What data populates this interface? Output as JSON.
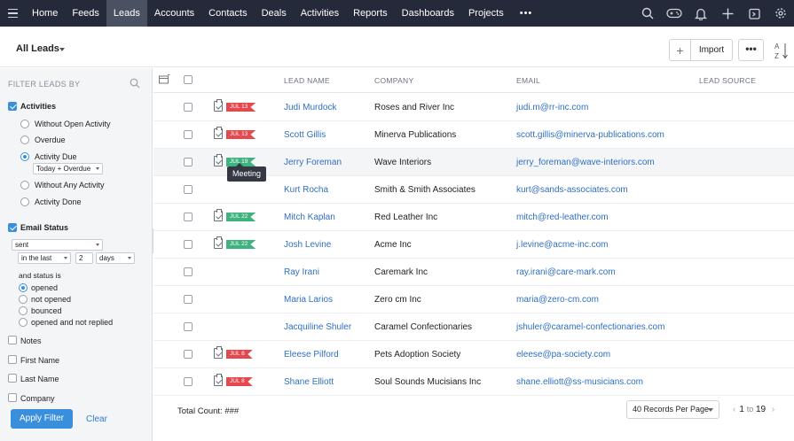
{
  "nav": {
    "tabs": [
      {
        "label": "Home",
        "active": false
      },
      {
        "label": "Feeds",
        "active": false
      },
      {
        "label": "Leads",
        "active": true
      },
      {
        "label": "Accounts",
        "active": false
      },
      {
        "label": "Contacts",
        "active": false
      },
      {
        "label": "Deals",
        "active": false
      },
      {
        "label": "Activities",
        "active": false
      },
      {
        "label": "Reports",
        "active": false
      },
      {
        "label": "Dashboards",
        "active": false
      },
      {
        "label": "Projects",
        "active": false
      }
    ],
    "more": "•••",
    "icons": [
      "search-icon",
      "gamepad-icon",
      "bell-icon",
      "plus-icon",
      "calendar-icon",
      "settings-icon"
    ]
  },
  "header": {
    "view_title": "All Leads",
    "import_label": "Import",
    "more_label": "•••",
    "plus_label": "+",
    "sort_label_a": "A",
    "sort_label_z": "Z"
  },
  "sidebar": {
    "heading": "FILTER LEADS BY",
    "activities": {
      "label": "Activities",
      "checked": true,
      "options": [
        {
          "label": "Without Open Activity",
          "selected": false
        },
        {
          "label": "Overdue",
          "selected": false
        },
        {
          "label": "Activity Due",
          "selected": true
        },
        {
          "label": "Without Any Activity",
          "selected": false
        },
        {
          "label": "Activity Done",
          "selected": false
        }
      ],
      "due_select": "Today + Overdue"
    },
    "email_status": {
      "label": "Email Status",
      "checked": true,
      "status_select": "sent",
      "range_select": "in the last",
      "range_value": "2",
      "unit_select": "days",
      "and_status_label": "and status is",
      "options": [
        {
          "label": "opened",
          "selected": true
        },
        {
          "label": "not opened",
          "selected": false
        },
        {
          "label": "bounced",
          "selected": false
        },
        {
          "label": "opened and not replied",
          "selected": false
        }
      ]
    },
    "fields": [
      {
        "label": "Notes",
        "checked": false
      },
      {
        "label": "First Name",
        "checked": false
      },
      {
        "label": "Last Name",
        "checked": false
      },
      {
        "label": "Company",
        "checked": false
      }
    ],
    "apply_label": "Apply Filter",
    "clear_label": "Clear"
  },
  "table": {
    "columns": [
      "LEAD NAME",
      "COMPANY",
      "EMAIL",
      "LEAD SOURCE"
    ],
    "rows": [
      {
        "name": "Judi Murdock",
        "company": "Roses and River Inc",
        "email": "judi.m@rr-inc.com",
        "tag": "JUL 13",
        "tag_color": "#e5484d"
      },
      {
        "name": "Scott Gillis",
        "company": "Minerva Publications",
        "email": "scott.gillis@minerva-publications.com",
        "tag": "JUL 13",
        "tag_color": "#e5484d"
      },
      {
        "name": "Jerry Foreman",
        "company": "Wave Interiors",
        "email": "jerry_foreman@wave-interiors.com",
        "tag": "JUL 19",
        "tag_color": "#3fb37f"
      },
      {
        "name": "Kurt Rocha",
        "company": "Smith & Smith Associates",
        "email": "kurt@sands-associates.com",
        "tag": "",
        "tag_color": ""
      },
      {
        "name": "Mitch Kaplan",
        "company": "Red Leather Inc",
        "email": "mitch@red-leather.com",
        "tag": "JUL 22",
        "tag_color": "#3fb37f"
      },
      {
        "name": "Josh Levine",
        "company": "Acme Inc",
        "email": "j.levine@acme-inc.com",
        "tag": "JUL 22",
        "tag_color": "#3fb37f"
      },
      {
        "name": "Ray Irani",
        "company": "Caremark Inc",
        "email": "ray.irani@care-mark.com",
        "tag": "",
        "tag_color": ""
      },
      {
        "name": "Maria Larios",
        "company": "Zero cm Inc",
        "email": "maria@zero-cm.com",
        "tag": "",
        "tag_color": ""
      },
      {
        "name": "Jacquiline Shuler",
        "company": "Caramel Confectionaries",
        "email": "jshuler@caramel-confectionaries.com",
        "tag": "",
        "tag_color": ""
      },
      {
        "name": "Eleese Pilford",
        "company": "Pets Adoption Society",
        "email": "eleese@pa-society.com",
        "tag": "JUL 8",
        "tag_color": "#e5484d"
      },
      {
        "name": "Shane Elliott",
        "company": "Soul Sounds Mucisians Inc",
        "email": "shane.elliott@ss-musicians.com",
        "tag": "JUL 8",
        "tag_color": "#e5484d"
      }
    ],
    "tooltip": "Meeting"
  },
  "footer": {
    "total_label": "Total Count: ###",
    "per_page": "40 Records Per Page",
    "page_from": "1",
    "page_to_label": "to",
    "page_to": "19"
  }
}
